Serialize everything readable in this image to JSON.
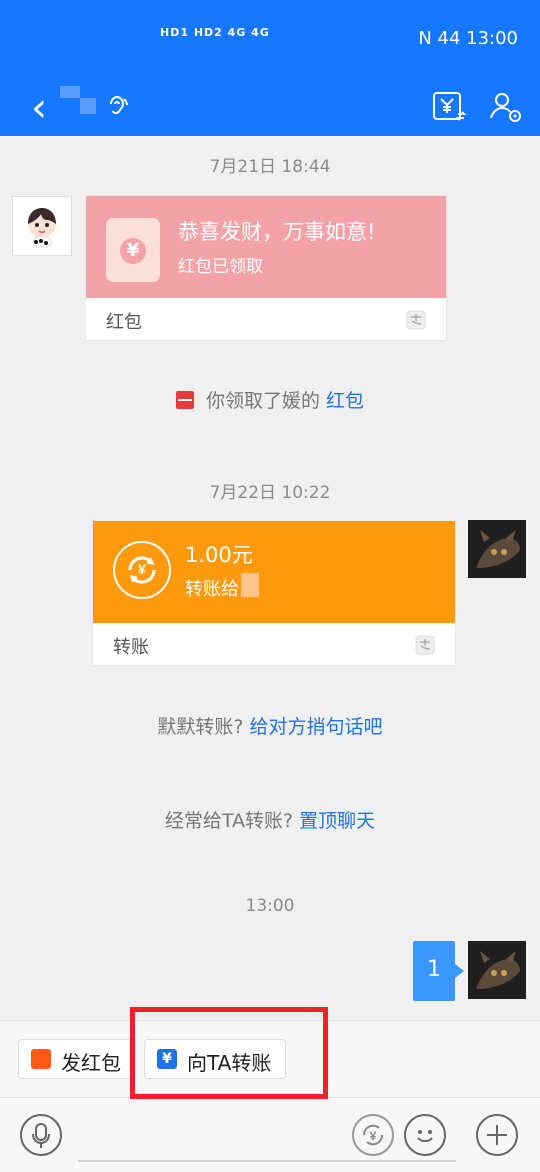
{
  "status_bar": {
    "left_text": "HD1 HD2 4G 4G",
    "right_text": "N  44  13:00"
  },
  "nav": {
    "back_symbol": "‹"
  },
  "messages": [
    {
      "type": "time",
      "text": "7月21日 18:44"
    },
    {
      "type": "red_packet",
      "title": "恭喜发财，万事如意!",
      "subtitle": "红包已领取",
      "label": "红包"
    },
    {
      "type": "system_red_packet",
      "text": "你领取了媛的 ",
      "link": "红包"
    },
    {
      "type": "time",
      "text": "7月22日 10:22"
    },
    {
      "type": "transfer",
      "amount": "1.00元",
      "desc": "转账给",
      "label": "转账"
    },
    {
      "type": "system_prompt",
      "text": "默默转账? ",
      "link": "给对方捎句话吧"
    },
    {
      "type": "system_prompt",
      "text": "经常给TA转账? ",
      "link": "置顶聊天"
    },
    {
      "type": "time",
      "text": "13:00"
    },
    {
      "type": "text",
      "text": "1"
    }
  ],
  "quick_actions": [
    {
      "label": "发红包"
    },
    {
      "label": "向TA转账"
    }
  ],
  "colors": {
    "header_blue": "#1677ff",
    "red_packet_pink": "#f3a3a8",
    "transfer_orange": "#ff9a0e",
    "link_blue": "#1f73e6",
    "highlight_red": "#f1212a"
  }
}
